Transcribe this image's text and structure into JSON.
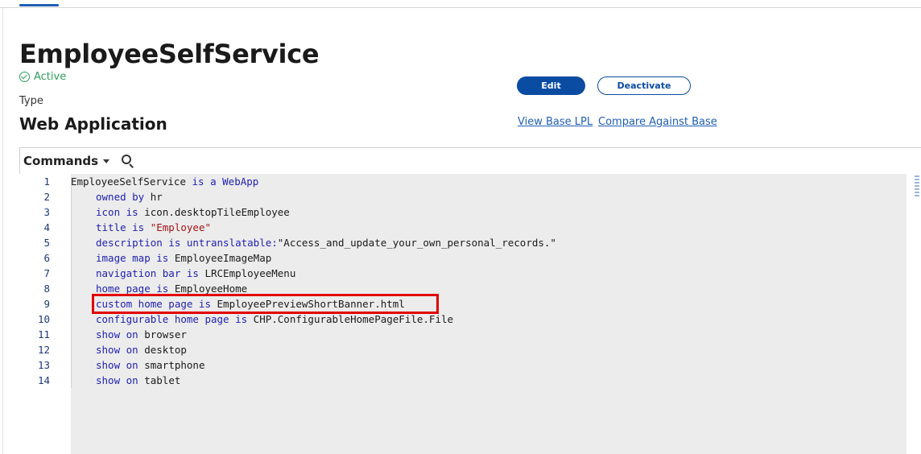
{
  "header": {
    "title": "EmployeeSelfService",
    "status": "Active",
    "type_label": "Type",
    "type_value": "Web Application"
  },
  "actions": {
    "edit_label": "Edit",
    "deactivate_label": "Deactivate",
    "view_base_label": "View Base LPL",
    "compare_label": "Compare Against Base"
  },
  "toolbar": {
    "commands_label": "Commands"
  },
  "editor": {
    "lines": [
      {
        "n": "1",
        "parts": [
          [
            "t",
            "EmployeeSelfService "
          ],
          [
            "k",
            "is a WebApp"
          ]
        ],
        "indent": 0
      },
      {
        "n": "2",
        "parts": [
          [
            "k",
            "owned by"
          ],
          [
            "t",
            " hr"
          ]
        ],
        "indent": 1
      },
      {
        "n": "3",
        "parts": [
          [
            "k",
            "icon is"
          ],
          [
            "t",
            " icon.desktopTileEmployee"
          ]
        ],
        "indent": 1
      },
      {
        "n": "4",
        "parts": [
          [
            "k",
            "title is "
          ],
          [
            "s",
            "\"Employee\""
          ]
        ],
        "indent": 1
      },
      {
        "n": "5",
        "parts": [
          [
            "k",
            "description is untranslatable:"
          ],
          [
            "t",
            "\"Access_and_update_your_own_personal_records.\""
          ]
        ],
        "indent": 1
      },
      {
        "n": "6",
        "parts": [
          [
            "k",
            "image map is"
          ],
          [
            "t",
            " EmployeeImageMap"
          ]
        ],
        "indent": 1
      },
      {
        "n": "7",
        "parts": [
          [
            "k",
            "navigation bar is"
          ],
          [
            "t",
            " LRCEmployeeMenu"
          ]
        ],
        "indent": 1
      },
      {
        "n": "8",
        "parts": [
          [
            "k",
            "home page is"
          ],
          [
            "t",
            " EmployeeHome"
          ]
        ],
        "indent": 1
      },
      {
        "n": "9",
        "parts": [
          [
            "k",
            "custom home page is"
          ],
          [
            "t",
            " EmployeePreviewShortBanner.html"
          ]
        ],
        "indent": 1
      },
      {
        "n": "10",
        "parts": [
          [
            "k",
            "configurable home page is"
          ],
          [
            "t",
            " CHP.ConfigurableHomePageFile.File"
          ]
        ],
        "indent": 1
      },
      {
        "n": "11",
        "parts": [
          [
            "k",
            "show on"
          ],
          [
            "t",
            " browser"
          ]
        ],
        "indent": 1
      },
      {
        "n": "12",
        "parts": [
          [
            "k",
            "show on"
          ],
          [
            "t",
            " desktop"
          ]
        ],
        "indent": 1
      },
      {
        "n": "13",
        "parts": [
          [
            "k",
            "show on"
          ],
          [
            "t",
            " smartphone"
          ]
        ],
        "indent": 1
      },
      {
        "n": "14",
        "parts": [
          [
            "k",
            "show on"
          ],
          [
            "t",
            " tablet"
          ]
        ],
        "indent": 1
      }
    ]
  },
  "colors": {
    "accent": "#0b4ca3",
    "status": "#2e9e5b",
    "highlight": "#e00000",
    "keyword": "#1f1fb0",
    "string": "#a31515"
  },
  "icons": {
    "status": "check-circle-icon",
    "commands": "chevron-down-icon",
    "search": "search-icon"
  }
}
